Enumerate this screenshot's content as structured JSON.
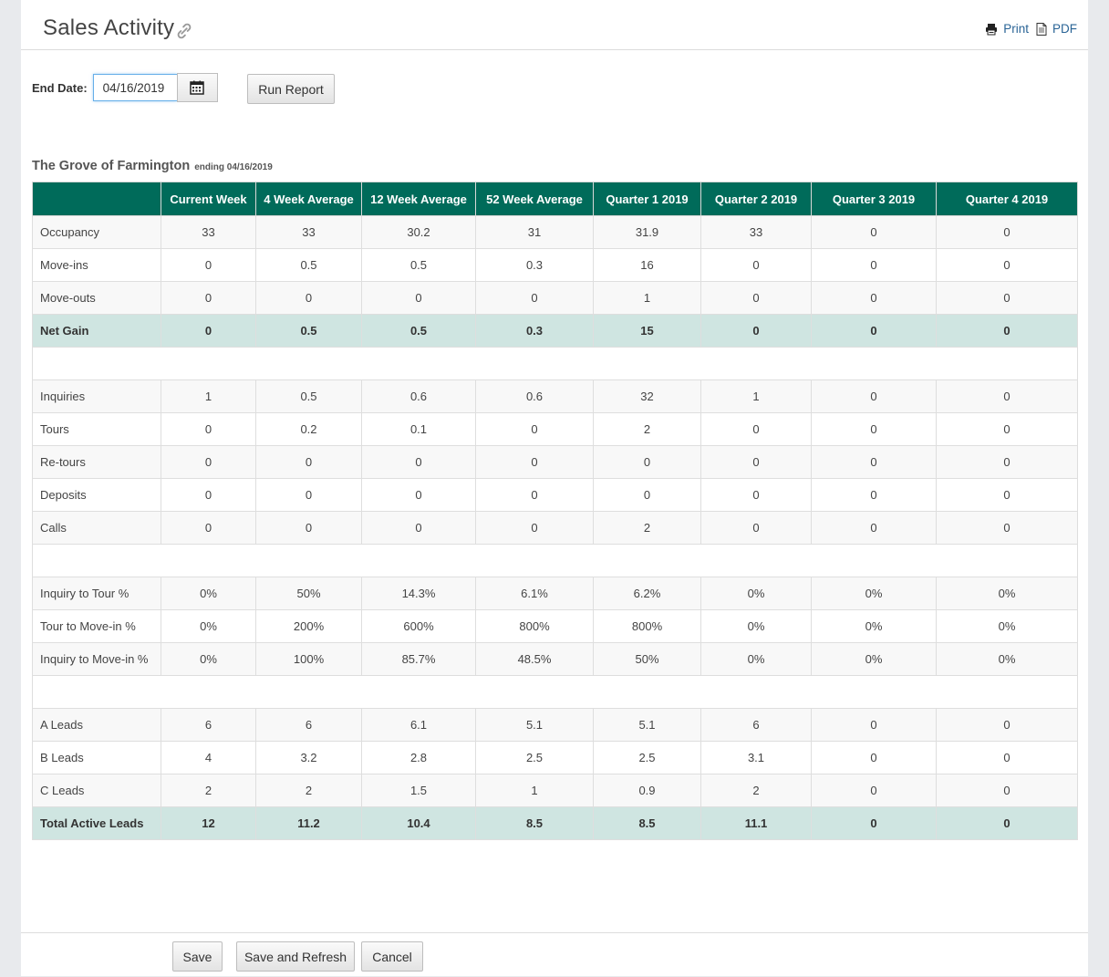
{
  "header": {
    "title": "Sales Activity",
    "print_label": "Print",
    "pdf_label": "PDF"
  },
  "form": {
    "end_date_label": "End Date:",
    "end_date_value": "04/16/2019",
    "run_report_label": "Run Report"
  },
  "report": {
    "community": "The Grove of Farmington",
    "ending_label": "ending 04/16/2019",
    "columns": [
      "",
      "Current Week",
      "4 Week Average",
      "12 Week Average",
      "52 Week Average",
      "Quarter 1 2019",
      "Quarter 2 2019",
      "Quarter 3 2019",
      "Quarter 4 2019"
    ],
    "rows": [
      {
        "label": "Occupancy",
        "values": [
          "33",
          "33",
          "30.2",
          "31",
          "31.9",
          "33",
          "0",
          "0"
        ],
        "style": "odd"
      },
      {
        "label": "Move-ins",
        "values": [
          "0",
          "0.5",
          "0.5",
          "0.3",
          "16",
          "0",
          "0",
          "0"
        ],
        "style": "even"
      },
      {
        "label": "Move-outs",
        "values": [
          "0",
          "0",
          "0",
          "0",
          "1",
          "0",
          "0",
          "0"
        ],
        "style": "odd"
      },
      {
        "label": "Net Gain",
        "values": [
          "0",
          "0.5",
          "0.5",
          "0.3",
          "15",
          "0",
          "0",
          "0"
        ],
        "style": "total"
      },
      {
        "label": "",
        "values": null,
        "style": "spacer"
      },
      {
        "label": "Inquiries",
        "values": [
          "1",
          "0.5",
          "0.6",
          "0.6",
          "32",
          "1",
          "0",
          "0"
        ],
        "style": "odd"
      },
      {
        "label": "Tours",
        "values": [
          "0",
          "0.2",
          "0.1",
          "0",
          "2",
          "0",
          "0",
          "0"
        ],
        "style": "even"
      },
      {
        "label": "Re-tours",
        "values": [
          "0",
          "0",
          "0",
          "0",
          "0",
          "0",
          "0",
          "0"
        ],
        "style": "odd"
      },
      {
        "label": "Deposits",
        "values": [
          "0",
          "0",
          "0",
          "0",
          "0",
          "0",
          "0",
          "0"
        ],
        "style": "even"
      },
      {
        "label": "Calls",
        "values": [
          "0",
          "0",
          "0",
          "0",
          "2",
          "0",
          "0",
          "0"
        ],
        "style": "odd"
      },
      {
        "label": "",
        "values": null,
        "style": "spacer"
      },
      {
        "label": "Inquiry to Tour %",
        "values": [
          "0%",
          "50%",
          "14.3%",
          "6.1%",
          "6.2%",
          "0%",
          "0%",
          "0%"
        ],
        "style": "odd"
      },
      {
        "label": "Tour to Move-in %",
        "values": [
          "0%",
          "200%",
          "600%",
          "800%",
          "800%",
          "0%",
          "0%",
          "0%"
        ],
        "style": "even"
      },
      {
        "label": "Inquiry to Move-in %",
        "values": [
          "0%",
          "100%",
          "85.7%",
          "48.5%",
          "50%",
          "0%",
          "0%",
          "0%"
        ],
        "style": "odd"
      },
      {
        "label": "",
        "values": null,
        "style": "spacer"
      },
      {
        "label": "A Leads",
        "values": [
          "6",
          "6",
          "6.1",
          "5.1",
          "5.1",
          "6",
          "0",
          "0"
        ],
        "style": "odd"
      },
      {
        "label": "B Leads",
        "values": [
          "4",
          "3.2",
          "2.8",
          "2.5",
          "2.5",
          "3.1",
          "0",
          "0"
        ],
        "style": "even"
      },
      {
        "label": "C Leads",
        "values": [
          "2",
          "2",
          "1.5",
          "1",
          "0.9",
          "2",
          "0",
          "0"
        ],
        "style": "odd"
      },
      {
        "label": "Total Active Leads",
        "values": [
          "12",
          "11.2",
          "10.4",
          "8.5",
          "8.5",
          "11.1",
          "0",
          "0"
        ],
        "style": "total"
      }
    ]
  },
  "footer": {
    "save_label": "Save",
    "save_refresh_label": "Save and Refresh",
    "cancel_label": "Cancel"
  },
  "icons": {
    "title_icon": "paperclip-icon",
    "print_icon": "printer-icon",
    "pdf_icon": "document-icon",
    "calendar_icon": "calendar-icon"
  },
  "colors": {
    "header_bg": "#006b5a",
    "total_row_bg": "#cfe5e1",
    "link": "#2a6496"
  }
}
